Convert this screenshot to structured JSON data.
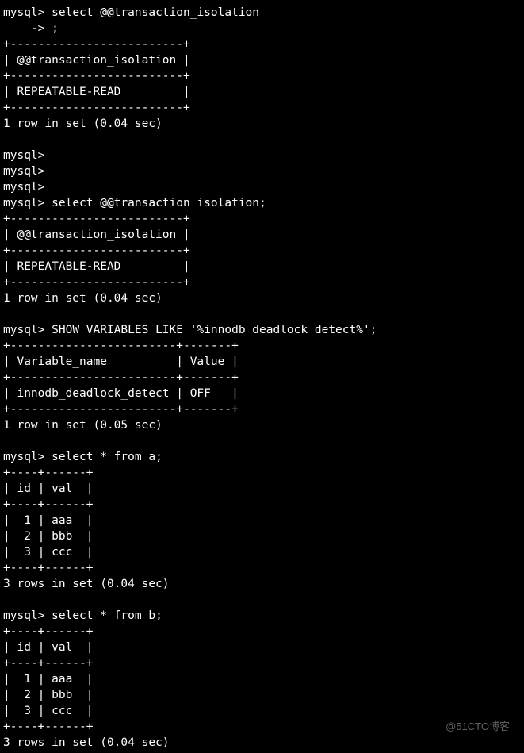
{
  "prompt": "mysql>",
  "cont_prompt": "    ->",
  "queries": {
    "q1_line1": "select @@transaction_isolation",
    "q1_line2": ";",
    "q2": "select @@transaction_isolation;",
    "q3": "SHOW VARIABLES LIKE '%innodb_deadlock_detect%';",
    "q4": "select * from a;",
    "q5": "select * from b;"
  },
  "results": {
    "r1": {
      "border": "+-------------------------+",
      "header": "| @@transaction_isolation |",
      "row": "| REPEATABLE-READ         |",
      "footer": "1 row in set (0.04 sec)"
    },
    "r2": {
      "border": "+-------------------------+",
      "header": "| @@transaction_isolation |",
      "row": "| REPEATABLE-READ         |",
      "footer": "1 row in set (0.04 sec)"
    },
    "r3": {
      "border": "+------------------------+-------+",
      "header": "| Variable_name          | Value |",
      "row": "| innodb_deadlock_detect | OFF   |",
      "footer": "1 row in set (0.05 sec)"
    },
    "r4": {
      "border": "+----+------+",
      "header": "| id | val  |",
      "rows": [
        "|  1 | aaa  |",
        "|  2 | bbb  |",
        "|  3 | ccc  |"
      ],
      "footer": "3 rows in set (0.04 sec)"
    },
    "r5": {
      "border": "+----+------+",
      "header": "| id | val  |",
      "rows": [
        "|  1 | aaa  |",
        "|  2 | bbb  |",
        "|  3 | ccc  |"
      ],
      "footer": "3 rows in set (0.04 sec)"
    }
  },
  "watermark": "@51CTO博客"
}
